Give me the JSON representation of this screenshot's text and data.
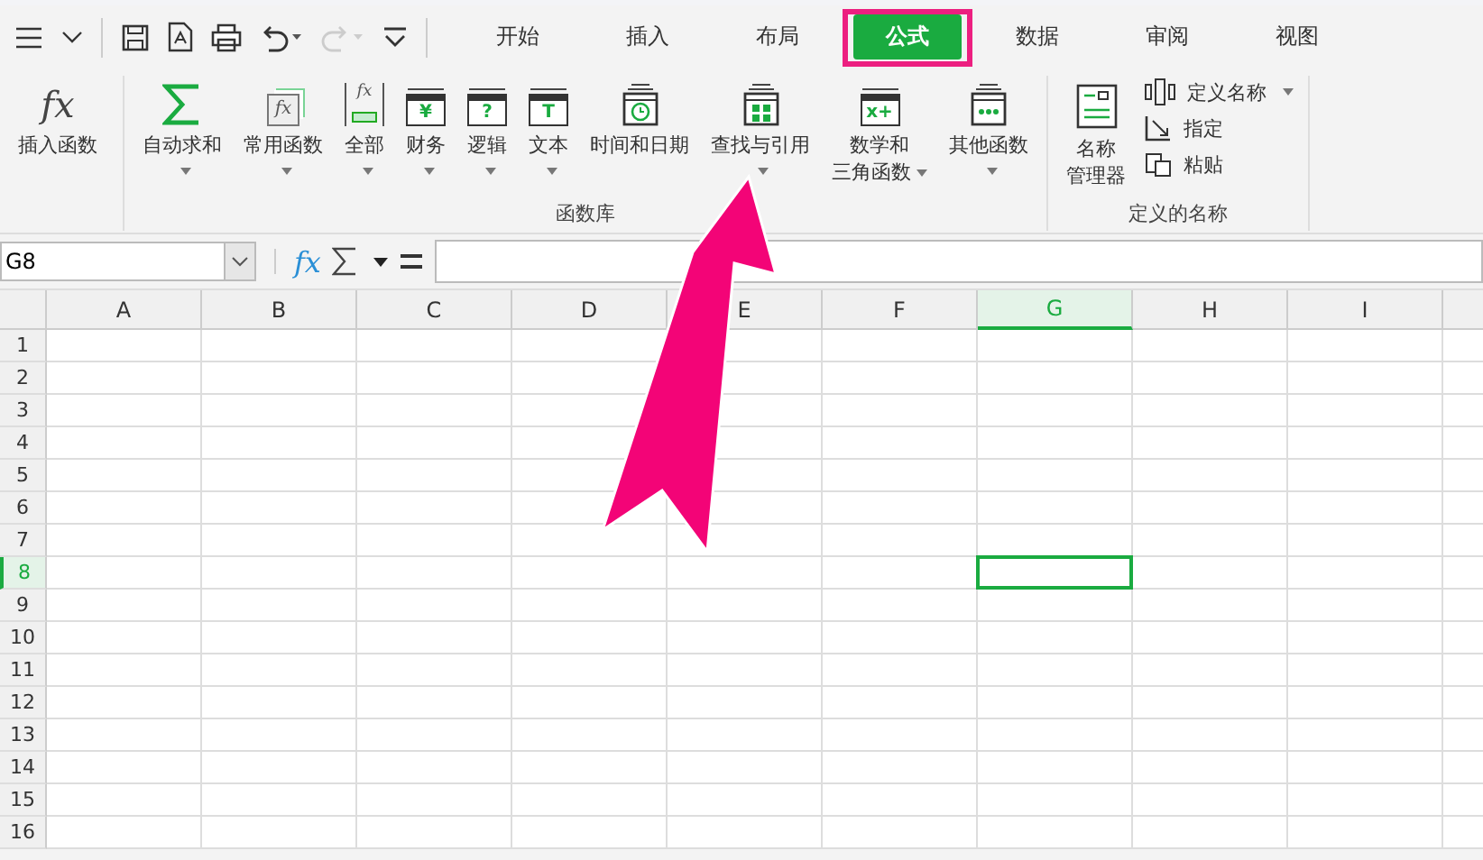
{
  "tabs": [
    {
      "label": "开始",
      "selected": false
    },
    {
      "label": "插入",
      "selected": false
    },
    {
      "label": "布局",
      "selected": false
    },
    {
      "label": "公式",
      "selected": true
    },
    {
      "label": "数据",
      "selected": false
    },
    {
      "label": "审阅",
      "selected": false
    },
    {
      "label": "视图",
      "selected": false
    }
  ],
  "ribbon": {
    "insert_function": {
      "glyph": "fx",
      "label": "插入函数"
    },
    "function_library": {
      "label": "函数库",
      "buttons": [
        {
          "kind": "sigma",
          "lines": [
            "自动求和"
          ],
          "dropdown": true
        },
        {
          "kind": "recent",
          "glyph": "fx",
          "lines": [
            "常用函数"
          ],
          "dropdown": true
        },
        {
          "kind": "all",
          "glyph": "fx",
          "lines": [
            "全部"
          ],
          "dropdown": true
        },
        {
          "kind": "book",
          "glyph": "¥",
          "lines": [
            "财务"
          ],
          "dropdown": true
        },
        {
          "kind": "book",
          "glyph": "?",
          "lines": [
            "逻辑"
          ],
          "dropdown": true
        },
        {
          "kind": "book",
          "glyph": "T",
          "lines": [
            "文本"
          ],
          "dropdown": true
        },
        {
          "kind": "clock",
          "lines": [
            "时间和日期"
          ],
          "dropdown": false
        },
        {
          "kind": "lookup",
          "lines": [
            "查找与引用"
          ],
          "dropdown": true
        },
        {
          "kind": "book",
          "glyph": "x+",
          "lines": [
            "数学和",
            "三角函数"
          ],
          "dropdown": true
        },
        {
          "kind": "more",
          "lines": [
            "其他函数"
          ],
          "dropdown": true
        }
      ]
    },
    "defined_names": {
      "label": "定义的名称",
      "manager": [
        "名称",
        "管理器"
      ],
      "small_buttons": [
        {
          "kind": "define",
          "label": "定义名称",
          "dropdown": true
        },
        {
          "kind": "assign",
          "label": "指定",
          "dropdown": false
        },
        {
          "kind": "paste",
          "label": "粘贴",
          "dropdown": false
        }
      ]
    }
  },
  "formula_bar": {
    "name_box": "G8",
    "function_glyph": "fx"
  },
  "columns": [
    {
      "label": "A",
      "selected": false
    },
    {
      "label": "B",
      "selected": false
    },
    {
      "label": "C",
      "selected": false
    },
    {
      "label": "D",
      "selected": false
    },
    {
      "label": "E",
      "selected": false
    },
    {
      "label": "F",
      "selected": false
    },
    {
      "label": "G",
      "selected": true
    },
    {
      "label": "H",
      "selected": false
    },
    {
      "label": "I",
      "selected": false
    }
  ],
  "rows": [
    {
      "label": "1",
      "selected": false
    },
    {
      "label": "2",
      "selected": false
    },
    {
      "label": "3",
      "selected": false
    },
    {
      "label": "4",
      "selected": false
    },
    {
      "label": "5",
      "selected": false
    },
    {
      "label": "6",
      "selected": false
    },
    {
      "label": "7",
      "selected": false
    },
    {
      "label": "8",
      "selected": true
    },
    {
      "label": "9",
      "selected": false
    },
    {
      "label": "10",
      "selected": false
    },
    {
      "label": "11",
      "selected": false
    },
    {
      "label": "12",
      "selected": false
    },
    {
      "label": "13",
      "selected": false
    },
    {
      "label": "14",
      "selected": false
    },
    {
      "label": "15",
      "selected": false
    },
    {
      "label": "16",
      "selected": false
    }
  ]
}
